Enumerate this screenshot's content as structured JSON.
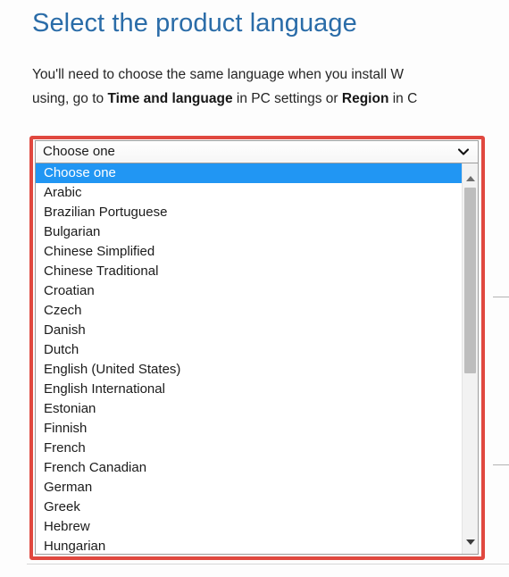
{
  "page": {
    "title": "Select the product language",
    "intro_line1": "You'll need to choose the same language when you install W",
    "intro_line2_pre": "using, go to ",
    "intro_line2_bold1": "Time and language",
    "intro_line2_mid": " in PC settings or ",
    "intro_line2_bold2": "Region",
    "intro_line2_post": " in C"
  },
  "combobox": {
    "selected_value": "Choose one",
    "chevron_icon": "chevron-down-icon",
    "expanded": true,
    "options": [
      "Choose one",
      "Arabic",
      "Brazilian Portuguese",
      "Bulgarian",
      "Chinese Simplified",
      "Chinese Traditional",
      "Croatian",
      "Czech",
      "Danish",
      "Dutch",
      "English (United States)",
      "English International",
      "Estonian",
      "Finnish",
      "French",
      "French Canadian",
      "German",
      "Greek",
      "Hebrew",
      "Hungarian"
    ],
    "highlighted_index": 0
  },
  "scrollbar": {
    "up_arrow_icon": "triangle-up-icon",
    "down_arrow_icon": "triangle-down-icon",
    "thumb_position": "top"
  },
  "annotation": {
    "highlight_color": "#e0483f"
  },
  "colors": {
    "heading": "#2a6ca8",
    "selection": "#2196f3",
    "annotation_red": "#e0483f"
  }
}
